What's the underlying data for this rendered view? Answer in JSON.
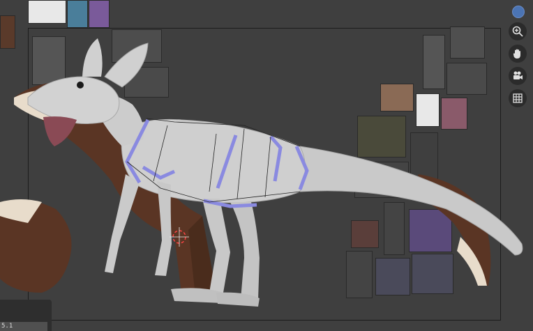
{
  "toolbar": {
    "scene_indicator": "scene-dot",
    "tools": [
      {
        "name": "zoom",
        "icon": "zoom-in-icon"
      },
      {
        "name": "pan",
        "icon": "hand-icon"
      },
      {
        "name": "camera",
        "icon": "camera-icon"
      },
      {
        "name": "grid",
        "icon": "grid-icon"
      }
    ]
  },
  "status": {
    "value": "5.1"
  },
  "colors": {
    "background": "#3f3f3f",
    "accent": "#4b74b4",
    "mesh": "#d6d6d6",
    "edge_select": "#8a8ae0"
  }
}
